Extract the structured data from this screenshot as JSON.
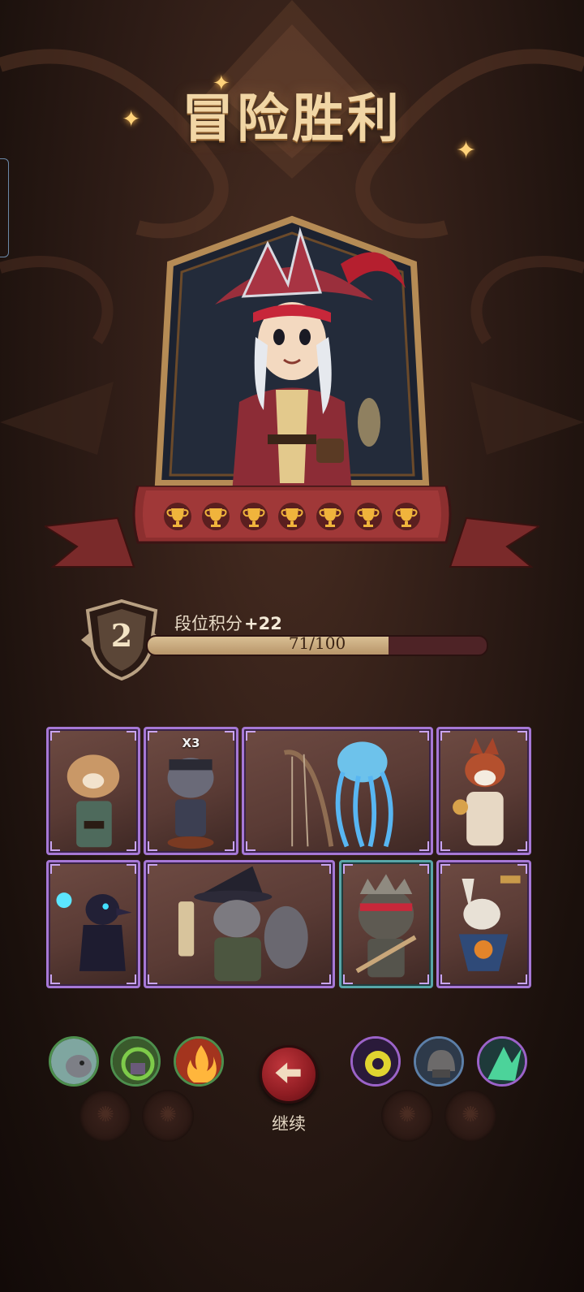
{
  "screen": {
    "title": "冒险胜利"
  },
  "hero": {
    "name_icon": "pirate-girl-portrait",
    "trophies": 7,
    "trophy_color": "#f0b43c"
  },
  "rank": {
    "level": "2",
    "label": "段位积分",
    "delta": "+22",
    "progress_text": "71/100",
    "progress_value": 71,
    "progress_max": 100
  },
  "cards": [
    {
      "icon": "hamster-sailor-card",
      "badge": ""
    },
    {
      "icon": "pirate-rat-card",
      "badge": "X3"
    },
    {
      "icon": "jellyfish-harp-card",
      "badge": ""
    },
    {
      "icon": "fox-card",
      "badge": ""
    },
    {
      "icon": "crow-card",
      "badge": ""
    },
    {
      "icon": "raccoon-wizard-card",
      "badge": ""
    },
    {
      "icon": "spiky-brawler-card",
      "badge": ""
    },
    {
      "icon": "rabbit-scarecrow-card",
      "badge": ""
    }
  ],
  "relics_left": [
    "grey-beast-icon",
    "green-vortex-icon",
    "flame-icon"
  ],
  "relics_right": [
    "eye-orb-icon",
    "helmet-icon",
    "green-fang-icon"
  ],
  "continue": {
    "label": "继续",
    "icon": "arrow-left-icon",
    "color": "#a8262c"
  }
}
